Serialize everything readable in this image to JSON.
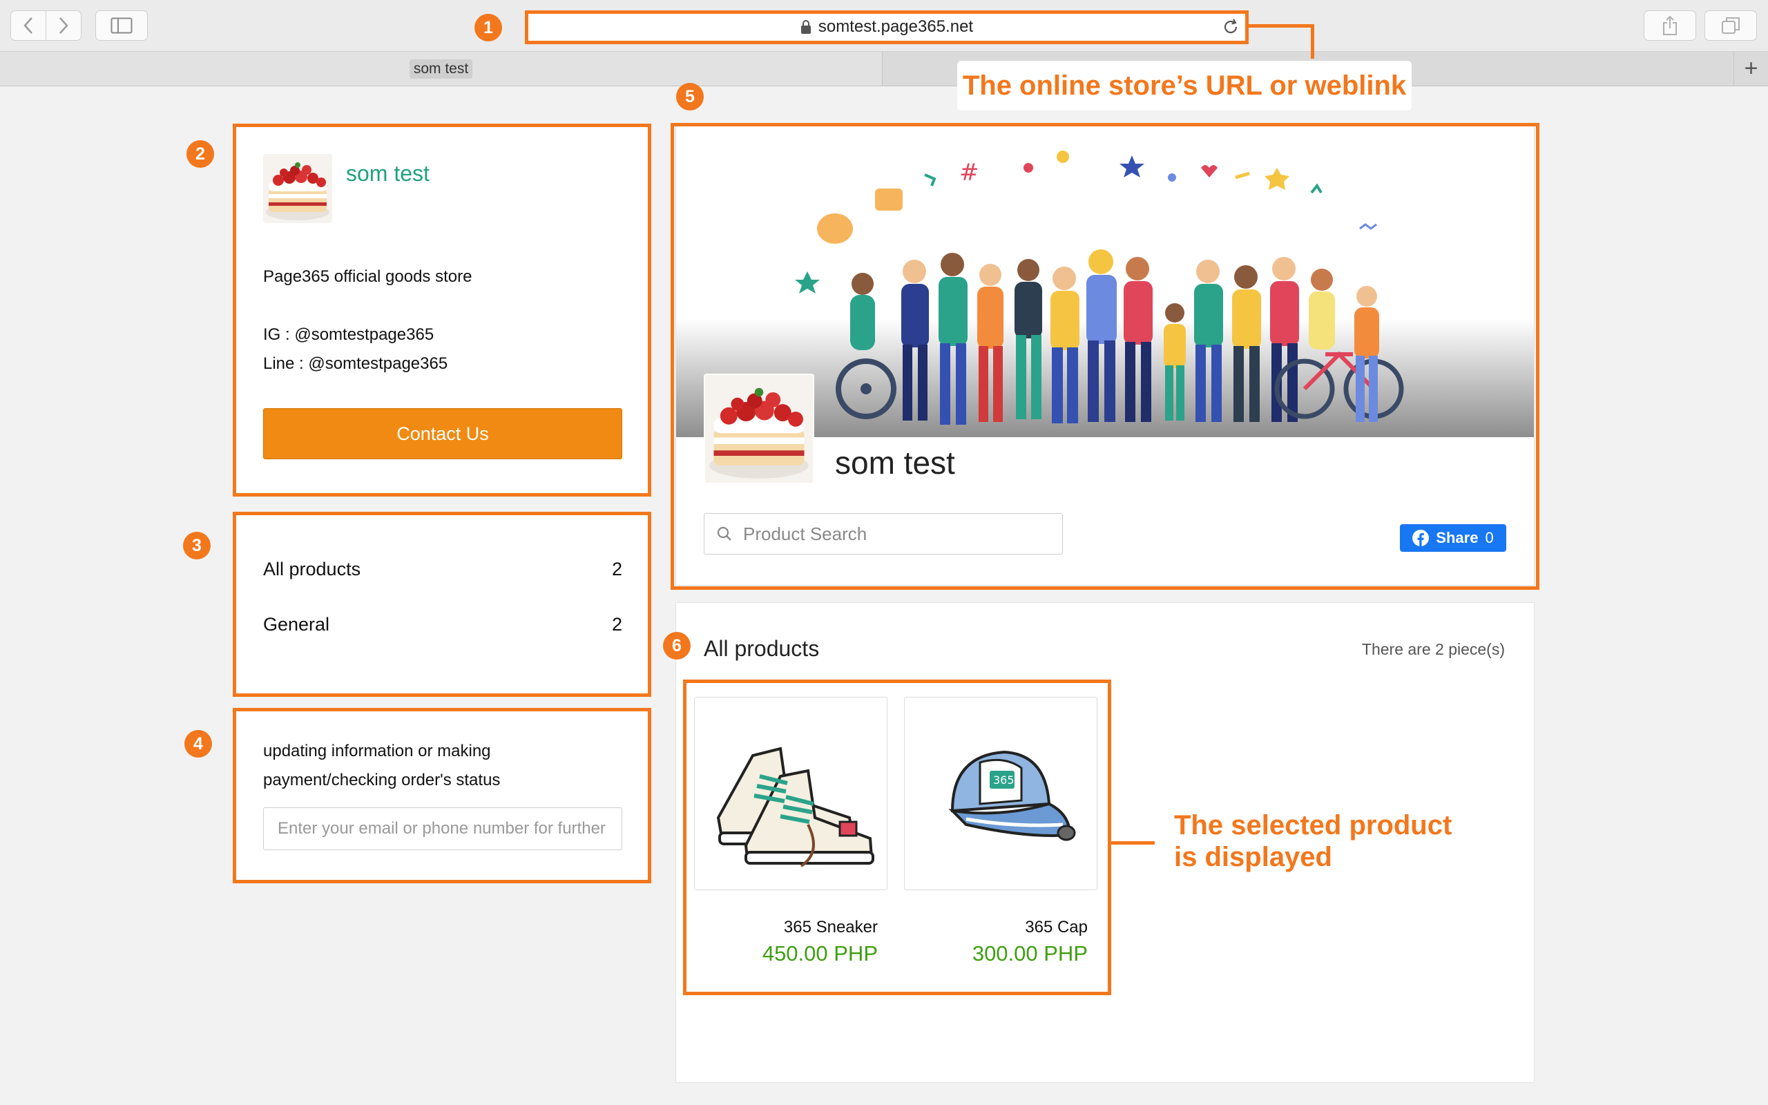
{
  "browser": {
    "url": "somtest.page365.net",
    "tab_title": "som test",
    "new_tab_symbol": "+"
  },
  "store": {
    "name": "som test",
    "description": "Page365 official goods store",
    "ig": "IG : @somtestpage365",
    "line": "Line : @somtestpage365",
    "contact_label": "Contact Us"
  },
  "categories": [
    {
      "name": "All products",
      "count": "2"
    },
    {
      "name": "General",
      "count": "2"
    }
  ],
  "order_status": {
    "text": "updating information or making payment/checking order's status",
    "placeholder": "Enter your email or phone number for further"
  },
  "banner": {
    "store_name": "som test",
    "search_placeholder": "Product Search",
    "share_label": "Share",
    "share_count": "0"
  },
  "products": {
    "title": "All products",
    "count_text": "There are 2 piece(s)",
    "items": [
      {
        "name": "365 Sneaker",
        "price": "450.00 PHP"
      },
      {
        "name": "365 Cap",
        "price": "300.00 PHP"
      }
    ]
  },
  "annotations": {
    "badges": [
      "1",
      "2",
      "3",
      "4",
      "5",
      "6"
    ],
    "url_label": "The online store’s URL or weblink",
    "product_label_line1": "The selected product",
    "product_label_line2": "is displayed",
    "color": "#f3771c"
  },
  "colors": {
    "store_name": "#1fa27a",
    "contact_button": "#f08a12",
    "price": "#3f9e12",
    "facebook": "#1877f2"
  },
  "icons": [
    "chevron-left-icon",
    "chevron-right-icon",
    "sidebar-icon",
    "lock-icon",
    "reload-icon",
    "share-icon",
    "tabs-icon",
    "search-icon",
    "facebook-icon"
  ]
}
